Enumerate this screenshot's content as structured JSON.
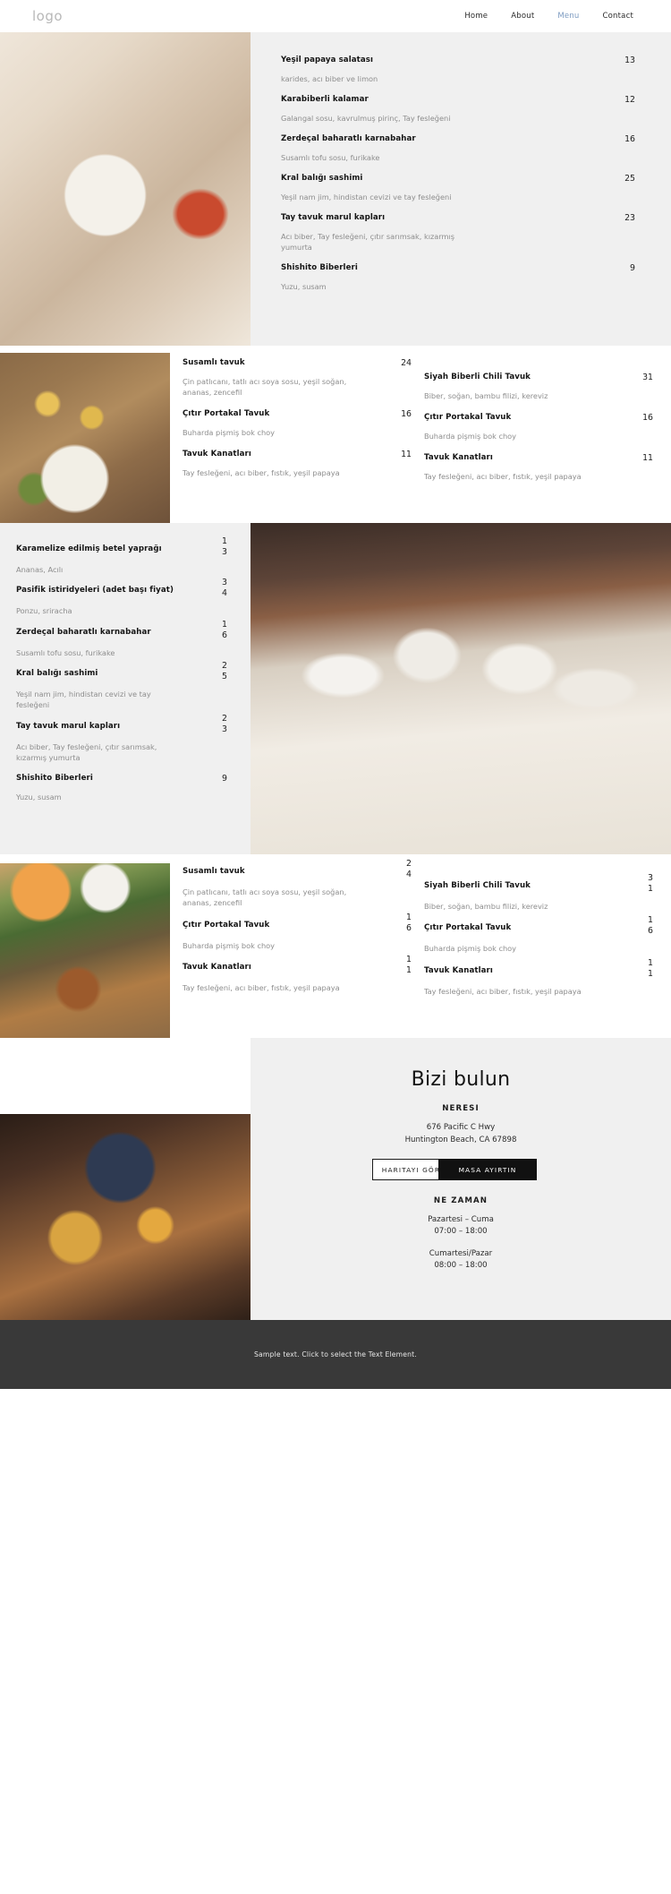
{
  "header": {
    "logo": "logo",
    "nav": [
      {
        "label": "Home",
        "active": false
      },
      {
        "label": "About",
        "active": false
      },
      {
        "label": "Menu",
        "active": true
      },
      {
        "label": "Contact",
        "active": false
      }
    ]
  },
  "section1": {
    "items": [
      {
        "name": "Yeşil papaya salatası",
        "price": "13",
        "desc": "karides, acı biber ve limon"
      },
      {
        "name": "Karabiberli kalamar",
        "price": "12",
        "desc": "Galangal sosu, kavrulmuş pirinç, Tay fesleğeni"
      },
      {
        "name": "Zerdeçal baharatlı karnabahar",
        "price": "16",
        "desc": "Susamlı tofu sosu, furikake"
      },
      {
        "name": "Kral balığı sashimi",
        "price": "25",
        "desc": "Yeşil nam jim, hindistan cevizi ve tay fesleğeni"
      },
      {
        "name": "Tay tavuk marul kapları",
        "price": "23",
        "desc": "Acı biber, Tay fesleğeni, çıtır sarımsak, kızarmış yumurta"
      },
      {
        "name": "Shishito Biberleri",
        "price": "9",
        "desc": "Yuzu, susam"
      }
    ]
  },
  "section2": {
    "col1": [
      {
        "name": "Susamlı tavuk",
        "price": "24",
        "desc": "Çin patlıcanı, tatlı acı soya sosu, yeşil soğan, ananas, zencefil"
      },
      {
        "name": "Çıtır Portakal Tavuk",
        "price": "16",
        "desc": "Buharda pişmiş bok choy"
      },
      {
        "name": "Tavuk Kanatları",
        "price": "11",
        "desc": "Tay fesleğeni, acı biber, fıstık, yeşil papaya"
      }
    ],
    "col2": [
      {
        "name": "Siyah Biberli Chili Tavuk",
        "price": "31",
        "desc": "Biber, soğan, bambu filizi, kereviz"
      },
      {
        "name": "Çıtır Portakal Tavuk",
        "price": "16",
        "desc": "Buharda pişmiş bok choy"
      },
      {
        "name": "Tavuk Kanatları",
        "price": "11",
        "desc": "Tay fesleğeni, acı biber, fıstık, yeşil papaya"
      }
    ]
  },
  "section3": {
    "items": [
      {
        "name": "Karamelize edilmiş betel yaprağı",
        "price": "13",
        "desc": "Ananas, Acılı"
      },
      {
        "name": "Pasifik istiridyeleri (adet başı fiyat)",
        "price": "34",
        "desc": "Ponzu, sriracha"
      },
      {
        "name": "Zerdeçal baharatlı karnabahar",
        "price": "16",
        "desc": "Susamlı tofu sosu, furikake"
      },
      {
        "name": "Kral balığı sashimi",
        "price": "25",
        "desc": "Yeşil nam jim, hindistan cevizi ve tay fesleğeni"
      },
      {
        "name": "Tay tavuk marul kapları",
        "price": "23",
        "desc": "Acı biber, Tay fesleğeni, çıtır sarımsak, kızarmış yumurta"
      },
      {
        "name": "Shishito Biberleri",
        "price": "9",
        "desc": "Yuzu, susam"
      }
    ]
  },
  "section4": {
    "col1": [
      {
        "name": "Susamlı tavuk",
        "price": "24",
        "desc": "Çin patlıcanı, tatlı acı soya sosu, yeşil soğan, ananas, zencefil"
      },
      {
        "name": "Çıtır Portakal Tavuk",
        "price": "16",
        "desc": "Buharda pişmiş bok choy"
      },
      {
        "name": "Tavuk Kanatları",
        "price": "11",
        "desc": "Tay fesleğeni, acı biber, fıstık, yeşil papaya"
      }
    ],
    "col2": [
      {
        "name": "Siyah Biberli Chili Tavuk",
        "price": "31",
        "desc": "Biber, soğan, bambu filizi, kereviz"
      },
      {
        "name": "Çıtır Portakal Tavuk",
        "price": "16",
        "desc": "Buharda pişmiş bok choy"
      },
      {
        "name": "Tavuk Kanatları",
        "price": "11",
        "desc": "Tay fesleğeni, acı biber, fıstık, yeşil papaya"
      }
    ]
  },
  "findus": {
    "title": "Bizi bulun",
    "where_label": "NERESI",
    "address_line1": "676 Pacific C Hwy",
    "address_line2": "Huntington Beach, CA 67898",
    "map_button": "HARITAYI GÖRÜN",
    "reserve_button": "MASA AYIRTIN",
    "when_label": "NE ZAMAN",
    "weekday_label": "Pazartesi – Cuma",
    "weekday_hours": "07:00 – 18:00",
    "weekend_label": "Cumartesi/Pazar",
    "weekend_hours": "08:00 – 18:00"
  },
  "bottombar": {
    "text": "Sample text. Click to select the Text Element."
  }
}
